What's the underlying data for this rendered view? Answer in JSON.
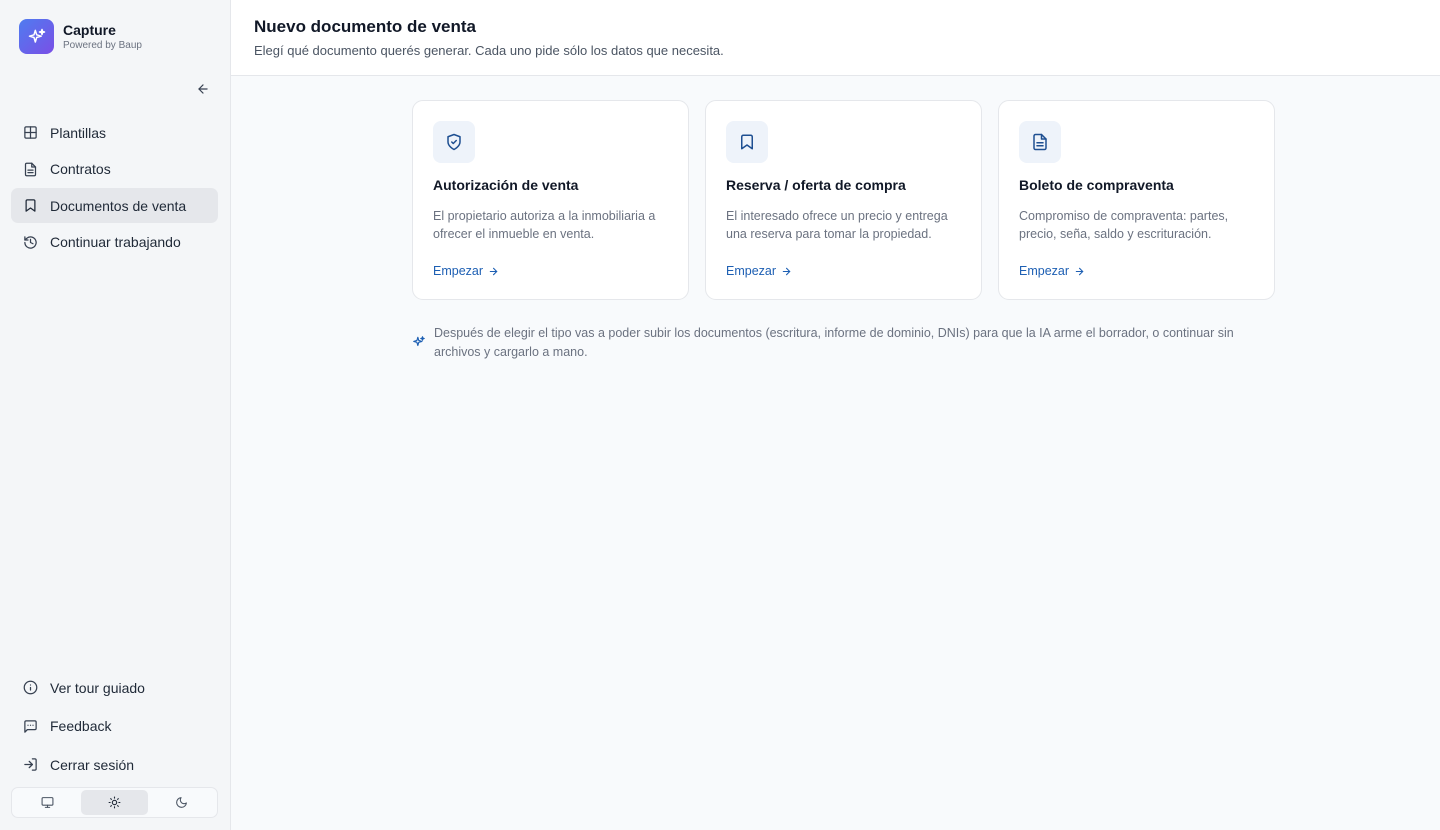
{
  "brand": {
    "name": "Capture",
    "subtitle": "Powered by Baup"
  },
  "sidebar": {
    "items": [
      {
        "label": "Plantillas",
        "icon": "grid-icon"
      },
      {
        "label": "Contratos",
        "icon": "file-text-icon"
      },
      {
        "label": "Documentos de venta",
        "icon": "bookmark-icon",
        "active": true
      },
      {
        "label": "Continuar trabajando",
        "icon": "history-icon"
      }
    ],
    "bottom_items": [
      {
        "label": "Ver tour guiado",
        "icon": "info-icon"
      },
      {
        "label": "Feedback",
        "icon": "message-icon"
      },
      {
        "label": "Cerrar sesión",
        "icon": "logout-icon"
      }
    ],
    "theme": {
      "options": [
        "monitor-icon",
        "sun-icon",
        "moon-icon"
      ],
      "selected": "sun-icon"
    }
  },
  "header": {
    "title": "Nuevo documento de venta",
    "subtitle": "Elegí qué documento querés generar. Cada uno pide sólo los datos que necesita."
  },
  "cards": [
    {
      "icon": "shield-check-icon",
      "title": "Autorización de venta",
      "description": "El propietario autoriza a la inmobiliaria a ofrecer el inmueble en venta.",
      "cta": "Empezar"
    },
    {
      "icon": "bookmark-icon",
      "title": "Reserva / oferta de compra",
      "description": "El interesado ofrece un precio y entrega una reserva para tomar la propiedad.",
      "cta": "Empezar"
    },
    {
      "icon": "file-text-icon",
      "title": "Boleto de compraventa",
      "description": "Compromiso de compraventa: partes, precio, seña, saldo y escrituración.",
      "cta": "Empezar"
    }
  ],
  "note": {
    "icon": "sparkles-icon",
    "text": "Después de elegir el tipo vas a poder subir los documentos (escritura, informe de dominio, DNIs) para que la IA arme el borrador, o continuar sin archivos y cargarlo a mano."
  },
  "colors": {
    "accent": "#1d5fb3",
    "brand_gradient_start": "#4f7cf0",
    "brand_gradient_end": "#7a4fe6"
  }
}
